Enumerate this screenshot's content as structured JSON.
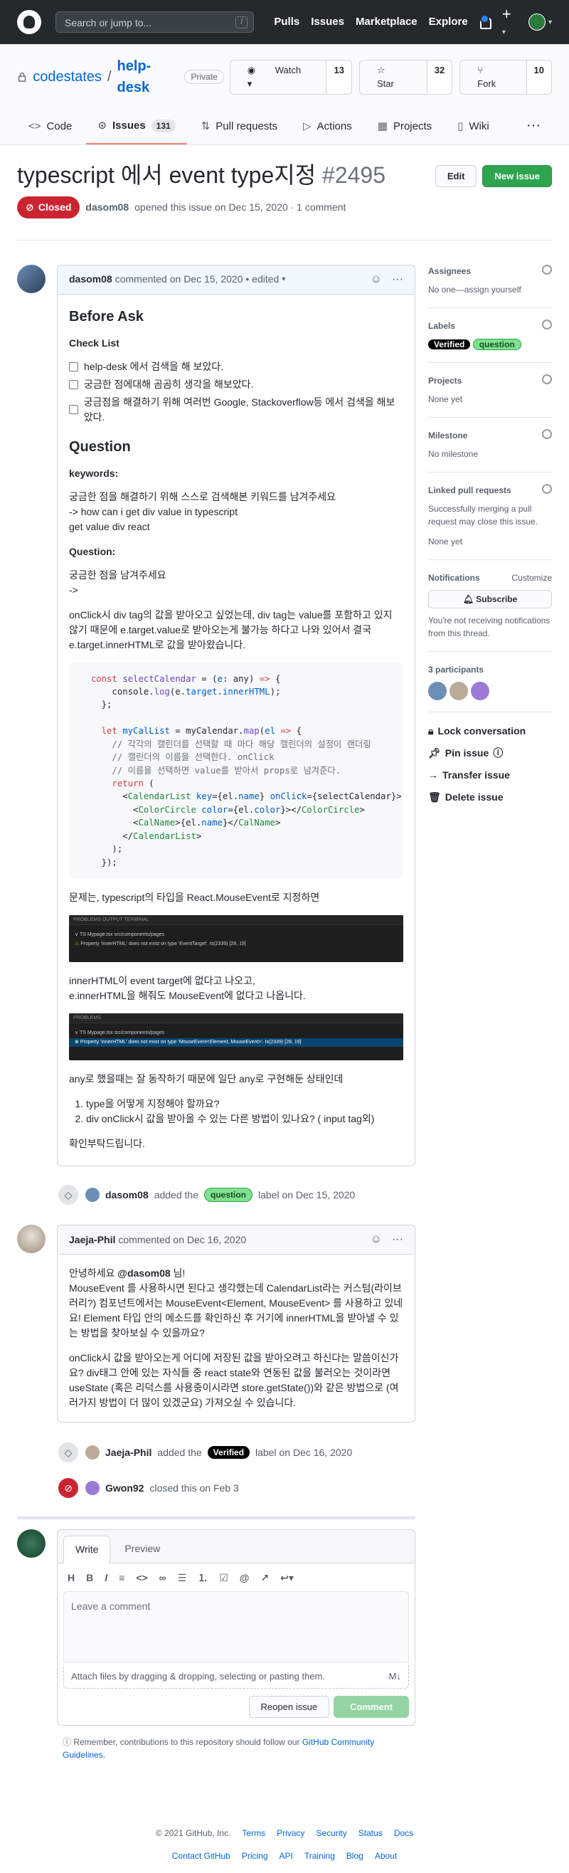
{
  "header": {
    "search_placeholder": "Search or jump to...",
    "slash": "/",
    "nav": [
      "Pulls",
      "Issues",
      "Marketplace",
      "Explore"
    ]
  },
  "repo": {
    "owner": "codestates",
    "name": "help-desk",
    "visibility": "Private",
    "watch": "Watch",
    "watch_count": "13",
    "star": "Star",
    "star_count": "32",
    "fork": "Fork",
    "fork_count": "10"
  },
  "tabs": [
    {
      "label": "Code"
    },
    {
      "label": "Issues",
      "count": "131"
    },
    {
      "label": "Pull requests"
    },
    {
      "label": "Actions"
    },
    {
      "label": "Projects"
    },
    {
      "label": "Wiki"
    }
  ],
  "issue": {
    "title": "typescript 에서 event type지정",
    "number": "#2495",
    "edit": "Edit",
    "new_issue": "New issue",
    "state": "Closed",
    "author": "dasom08",
    "meta": "opened this issue on Dec 15, 2020 · 1 comment"
  },
  "comment1": {
    "author": "dasom08",
    "meta": "commented on Dec 15, 2020 • edited",
    "h_before": "Before Ask",
    "h_check": "Check List",
    "tasks": [
      "help-desk 에서 검색을 해 보았다.",
      "궁금한 점에대해 곰곰히 생각을 해보았다.",
      "궁금점을 해결하기 위해 여러번 Google, Stackoverflow등 에서 검색을 해보았다."
    ],
    "h_question": "Question",
    "h_keywords": "keywords:",
    "kw1": "궁금한 점을 해결하기 위해 스스로 검색해본 키워드를 남겨주세요",
    "kw2": "-> how can i get div value in typescript",
    "kw3": "get value div react",
    "h_q2": "Question:",
    "q1": "궁금한 점을 남겨주세요",
    "q2": "->",
    "p1": "onClick시 div tag의 값을 받아오고 싶었는데, div tag는 value를 포함하고 있지 않기 때문에 e.target.value로 받아오는게 불가능 하다고 나와 있어서 결국 e.target.innerHTML로 값을 받아왔습니다.",
    "p2": "문제는, typescript의 타입을 React.MouseEvent로 지정하면",
    "shot1_line1": "PROBLEMS   OUTPUT   TERMINAL",
    "shot1_line2": "∨ TS  Mypage.tsx  src/components/pages",
    "shot1_line3": "Property 'innerHTML' does not exist on type 'EventTarget'. ts(2339) [28, 19]",
    "p3a": "innerHTML이 event target에 없다고 나오고,",
    "p3b": "e.innerHTML을 해줘도 MouseEvent에 없다고 나옵니다.",
    "shot2_line1": "PROBLEMS",
    "shot2_line2": "∨ TS  Mypage.tsx  src/components/pages",
    "shot2_line3": "Property 'innerHTML' does not exist on type 'MouseEvent<Element, MouseEvent>'. ts(2339) [28, 19]",
    "p4": "any로 했을때는 잘 동작하기 때문에 일단 any로 구현해둔 상태인데",
    "ol": [
      "type을 어떻게 지정해야 할까요?",
      "div onClick시 값을 받아올 수 있는 다른 방법이 있나요? ( input tag외)"
    ],
    "p5": "확인부탁드립니다."
  },
  "event1": {
    "author": "dasom08",
    "text1": "added the",
    "label": "question",
    "text2": "label on Dec 15, 2020"
  },
  "comment2": {
    "author": "Jaeja-Phil",
    "meta": "commented on Dec 16, 2020",
    "p1a": "안녕하세요 ",
    "mention": "@dasom08",
    "p1b": " 님!",
    "p2": "MouseEvent 를 사용하시면 된다고 생각했는데 CalendarList라는 커스텀(라이브러리?) 컴포넌트에서는 MouseEvent<Element, MouseEvent> 를 사용하고 있네요! Element 타입 안의 메소드를 확인하신 후 거기에 innerHTML을 받아낼 수 있는 방법을 찾아보실 수 있을까요?",
    "p3": "onClick시 값을 받아오는게 어디에 저장된 값을 받아오려고 하신다는 말씀이신가요? div태그 안에 있는 자식들 중 react state와 연동된 값을 불러오는 것이라면 useState (혹은 리덕스를 사용중이시라면 store.getState())와 같은 방법으로 (여러가지 방법이 더 많이 있겠군요) 가져오실 수 있습니다."
  },
  "event2": {
    "author": "Jaeja-Phil",
    "text1": "added the",
    "label": "Verified",
    "text2": "label on Dec 16, 2020"
  },
  "event3": {
    "author": "Gwon92",
    "text": "closed this on Feb 3"
  },
  "newcomment": {
    "tab_write": "Write",
    "tab_preview": "Preview",
    "placeholder": "Leave a comment",
    "attach": "Attach files by dragging & dropping, selecting or pasting them.",
    "reopen": "Reopen issue",
    "submit": "Comment",
    "remember": "Remember, contributions to this repository should follow our ",
    "guidelines": "GitHub Community Guidelines",
    "period": "."
  },
  "sidebar": {
    "assignees": "Assignees",
    "assignees_val": "No one—assign yourself",
    "labels": "Labels",
    "label1": "Verified",
    "label2": "question",
    "projects": "Projects",
    "projects_val": "None yet",
    "milestone": "Milestone",
    "milestone_val": "No milestone",
    "linked": "Linked pull requests",
    "linked_desc": "Successfully merging a pull request may close this issue.",
    "linked_val": "None yet",
    "notifications": "Notifications",
    "customize": "Customize",
    "subscribe": "Subscribe",
    "notif_desc": "You're not receiving notifications from this thread.",
    "participants": "3 participants",
    "lock": "Lock conversation",
    "pin": "Pin issue",
    "transfer": "Transfer issue",
    "delete": "Delete issue"
  },
  "footer": {
    "copyright": "© 2021 GitHub, Inc.",
    "row1": [
      "Terms",
      "Privacy",
      "Security",
      "Status",
      "Docs"
    ],
    "row2": [
      "Contact GitHub",
      "Pricing",
      "API",
      "Training",
      "Blog",
      "About"
    ]
  },
  "colors": {
    "closed": "#cb2431",
    "green": "#2ea44f",
    "link": "#0366d6",
    "question_label": "#7fe18f",
    "verified_label": "#000000"
  }
}
